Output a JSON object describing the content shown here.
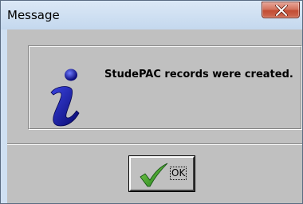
{
  "window": {
    "title": "Message",
    "close_icon": "close-x-icon"
  },
  "dialog": {
    "icon": "information-icon",
    "message": "StudePAC records were created.",
    "ok_button": {
      "label": "OK",
      "icon": "green-checkmark-icon"
    }
  },
  "colors": {
    "client_background": "#c0c0c0",
    "titlebar": "#cfe0f2",
    "close_button": "#c24c33",
    "info_icon": "#1c1ca8",
    "checkmark": "#2e9a2a"
  }
}
